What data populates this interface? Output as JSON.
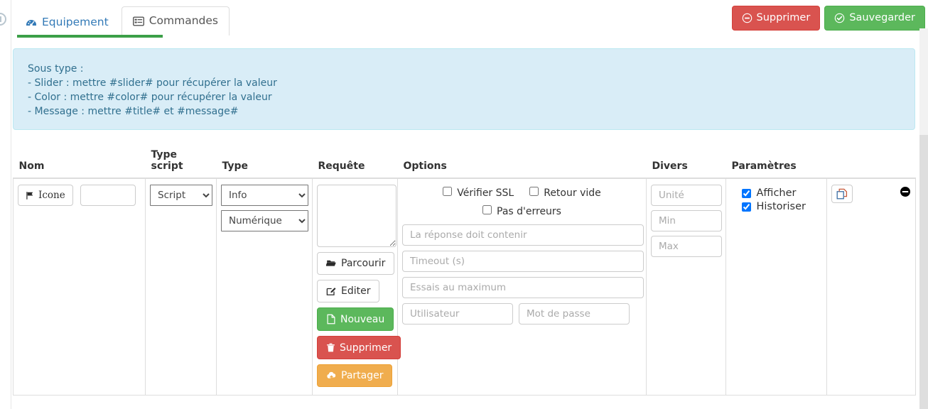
{
  "window": {
    "edge_icon": "circle-info-icon"
  },
  "tabs": [
    {
      "label": "Equipement",
      "icon": "dashboard-icon",
      "active": false
    },
    {
      "label": "Commandes",
      "icon": "list-alt-icon",
      "active": true
    }
  ],
  "header_buttons": [
    {
      "label": "Supprimer",
      "icon": "minus-circle-icon",
      "style": "danger"
    },
    {
      "label": "Sauvegarder",
      "icon": "check-circle-icon",
      "style": "success"
    }
  ],
  "alert": {
    "line1": "Sous type :",
    "line2": "- Slider : mettre #slider# pour récupérer la valeur",
    "line3": "- Color : mettre #color# pour récupérer la valeur",
    "line4": "- Message : mettre #title# et #message#"
  },
  "table": {
    "headers": {
      "nom": "Nom",
      "type_script": "Type script",
      "type": "Type",
      "requete": "Requête",
      "options": "Options",
      "divers": "Divers",
      "parametres": "Paramètres",
      "actions": ""
    },
    "row": {
      "nom": {
        "icone_button": "Icone",
        "icone_icon": "flag-icon",
        "name_value": "",
        "name_placeholder": ""
      },
      "type_script": {
        "selected": "Script",
        "options": [
          "Script"
        ]
      },
      "type": {
        "selected": "Info",
        "options": [
          "Info"
        ],
        "subtype_selected": "Numérique",
        "subtype_options": [
          "Numérique"
        ]
      },
      "requete": {
        "textarea_value": "",
        "buttons": [
          {
            "label": "Parcourir",
            "icon": "folder-open-icon",
            "style": "default"
          },
          {
            "label": "Editer",
            "icon": "pencil-square-icon",
            "style": "default"
          },
          {
            "label": "Nouveau",
            "icon": "file-icon",
            "style": "success"
          },
          {
            "label": "Supprimer",
            "icon": "trash-icon",
            "style": "danger"
          },
          {
            "label": "Partager",
            "icon": "cloud-upload-icon",
            "style": "warning"
          }
        ]
      },
      "options": {
        "checks": [
          {
            "label": "Vérifier SSL",
            "checked": false
          },
          {
            "label": "Retour vide",
            "checked": false
          },
          {
            "label": "Pas d'erreurs",
            "checked": false
          }
        ],
        "response_contains_placeholder": "La réponse doit contenir",
        "response_contains_value": "",
        "timeout_placeholder": "Timeout (s)",
        "timeout_value": "",
        "max_tries_placeholder": "Essais au maximum",
        "max_tries_value": "",
        "user_placeholder": "Utilisateur",
        "user_value": "",
        "password_placeholder": "Mot de passe",
        "password_value": ""
      },
      "divers": {
        "unite_placeholder": "Unité",
        "unite_value": "",
        "min_placeholder": "Min",
        "min_value": "",
        "max_placeholder": "Max",
        "max_value": ""
      },
      "parametres": {
        "afficher_label": "Afficher",
        "afficher_checked": true,
        "historiser_label": "Historiser",
        "historiser_checked": true
      },
      "actions": {
        "copy_icon": "copy-icon",
        "remove_icon": "minus-circle-filled-icon"
      }
    }
  },
  "colors": {
    "accent_green": "#3c9f48",
    "danger": "#d9534f",
    "success": "#5cb85c",
    "warning": "#f0ad4e",
    "link": "#337ab7",
    "alert_bg": "#d9edf7",
    "alert_border": "#bce8f1",
    "alert_text": "#31708f"
  }
}
